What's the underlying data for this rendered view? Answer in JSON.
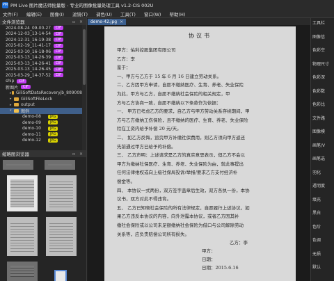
{
  "app": {
    "logo_text": "PM",
    "title": "PM Live 图片魔法师批量版 - 专业的图像批量处理工具 v1.2-CIS 002U"
  },
  "menu": [
    "文件(F)",
    "编辑(E)",
    "图像(I)",
    "滤镜(T)",
    "调色(U)",
    "工具(T)",
    "窗口(W)",
    "帮助(H)"
  ],
  "file_browser": {
    "title": "文件浏览器",
    "controls": "▫ ×",
    "rows": [
      {
        "label": "2024-08-24_09-00-27",
        "badge": "CIF",
        "badge_type": "cif"
      },
      {
        "label": "2024-12-03_13-14-54",
        "badge": "CIF",
        "badge_type": "cif"
      },
      {
        "label": "2024-12-31_16-19-38",
        "badge": "CIF",
        "badge_type": "cif"
      },
      {
        "label": "2025-02-19_11-41-17",
        "badge": "CIF",
        "badge_type": "cif"
      },
      {
        "label": "2025-03-10_16-18-06",
        "badge": "CIF",
        "badge_type": "cif"
      },
      {
        "label": "2025-03-13_14-26-39",
        "badge": "CIF",
        "badge_type": "cif"
      },
      {
        "label": "2025-03-13_14-26-41",
        "badge": "CIF",
        "badge_type": "cif"
      },
      {
        "label": "2025-03-13_14-26-45",
        "badge": "CIF",
        "badge_type": "cif"
      },
      {
        "label": "2025-03-29_14-37-52",
        "badge": "CIF",
        "badge_type": "cif"
      },
      {
        "label": "ship",
        "badge": "CIF",
        "badge_type": "cif"
      },
      {
        "label": "新图片",
        "badge": "CIF",
        "badge_type": "cif"
      }
    ],
    "folders": [
      {
        "label": "GiliSoftDataRecoveryjb_809008",
        "expanded": false
      },
      {
        "label": "GiliSoftFileLock",
        "expanded": false
      },
      {
        "label": "output",
        "expanded": false
      },
      {
        "label": "图例",
        "expanded": true,
        "selected": true
      }
    ],
    "files": [
      {
        "label": "demo-08",
        "badge": "JPG"
      },
      {
        "label": "demo-09",
        "badge": "JPG"
      },
      {
        "label": "demo-10",
        "badge": "JPG"
      },
      {
        "label": "demo-11",
        "badge": "JPG"
      },
      {
        "label": "demo-12",
        "badge": "JPG"
      }
    ]
  },
  "thumbnail_browser": {
    "title": "缩略图浏览器",
    "controls": "▫ ×"
  },
  "tab": {
    "label": "demo-42.jpg",
    "close": "×"
  },
  "document": {
    "title": "协议书",
    "lines": [
      "甲方：佑利控股集团有限公司",
      "乙方：李",
      "鉴于：",
      "一、甲方与乙方于 15 年 6 月 16 日建立劳动关系。",
      "二、乙方因甲方申请，自愿不缴纳医疗、生育、养老、失业保险",
      "为此，甲方与乙方，自愿不缴纳社会保险的相关规定，甲",
      "方与乙方协商一致，自愿不缴纳以下条款作为依据：",
      "一、    甲方已考虑乙方的要求，自乙方与甲方劳动关系存续期间，甲",
      "方与乙方缴纳工伤保险，且不缴纳的医疗、生育、养老、失业保险",
      "险在工资内给予补偿  20  元/天。",
      "二、    如乙方反悔，追究甲方补缴社保费用，则乙方须向甲方返还",
      "先前通过甲方已给予的补偿。",
      "三、    乙方声明：上述请求是乙方的真实意思表示，但乙方不会以",
      "甲方为缴纳社保医疗、生育、养老、失业保险为由，就此事提出",
      "任何法律维权或向上级社保局投诉/举报/要求乙方支付经济补",
      "偿金等。",
      "四、    本协议一式两份，双方签字盖章后生效，双方各执一份，本协",
      "议书，双方对此不得违背。",
      "五、    乙方已知晓社会保险的所有法律规定，自愿履行上述协议，如",
      "果乙方违反本协议的内容，向外泄露本协议，或者乙方因其补",
      "缴社会保险或以公司未足额缴纳社会保险为借口与公司解除劳动",
      "关系等，应负责赔偿公司所有损失。",
      "乙方：李",
      "甲方：",
      "日期：",
      "日期：2015.6.16"
    ]
  },
  "right_panel": {
    "rows": [
      "工具栏",
      "图像信",
      "色彩空",
      "物理尺寸",
      "色彩深",
      "色彩数",
      "色彩比",
      "文件路",
      "图像模",
      "画笔/V",
      "画笔选",
      "羽化",
      "透明度",
      "填充",
      "黑白",
      "色阶",
      "色调",
      "无损",
      "默认"
    ]
  }
}
